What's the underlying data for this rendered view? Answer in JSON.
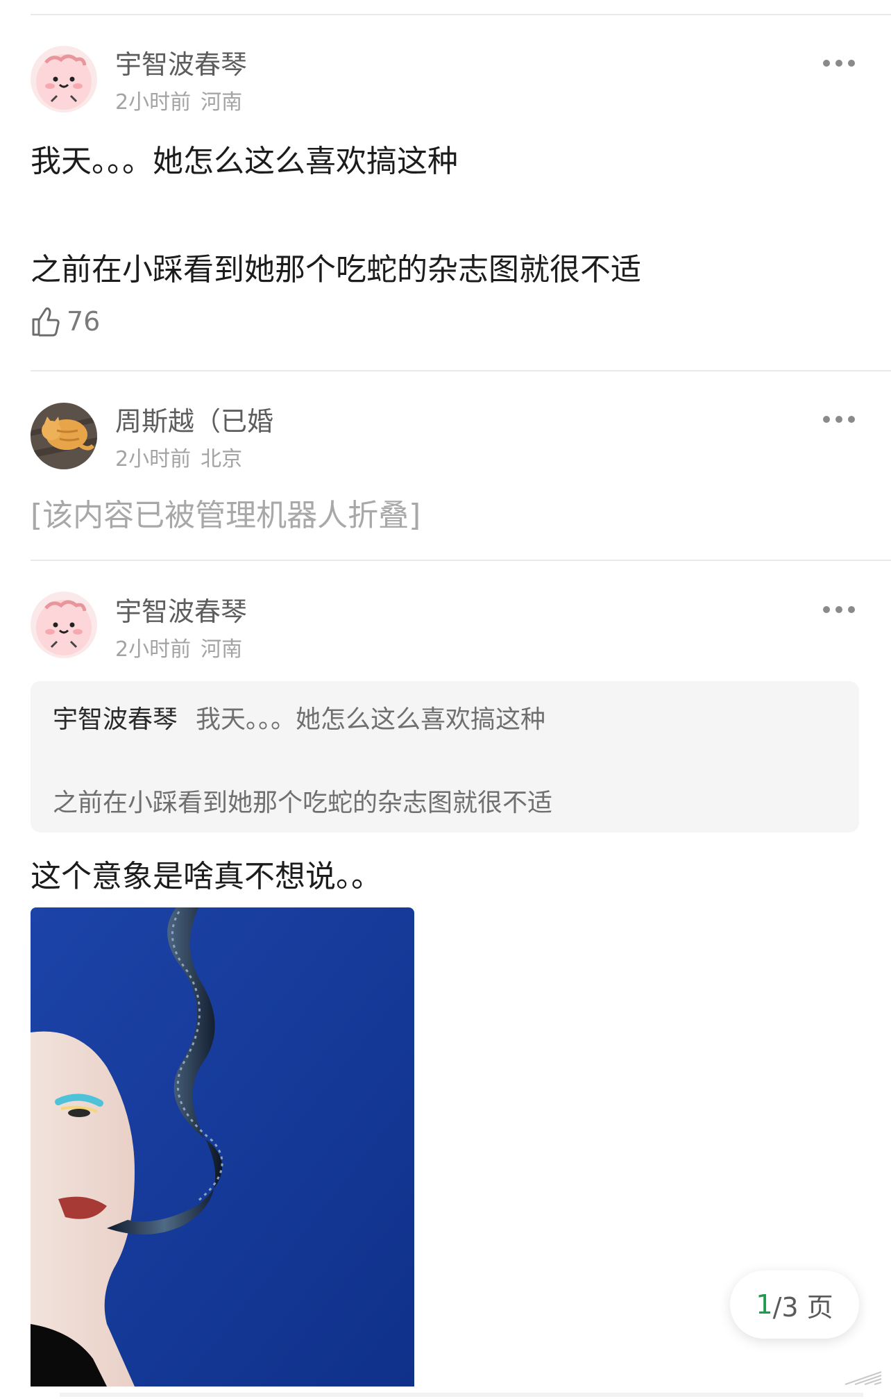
{
  "posts": [
    {
      "username": "宇智波春琴",
      "time": "2小时前",
      "location": "河南",
      "lines": [
        "我天。。。她怎么这么喜欢搞这种",
        "之前在小踩看到她那个吃蛇的杂志图就很不适"
      ],
      "likes": "76",
      "avatar_icon": "pink-blob-avatar-icon"
    },
    {
      "username": "周斯越（已婚",
      "time": "2小时前",
      "location": "北京",
      "folded_notice": "[该内容已被管理机器人折叠]",
      "avatar_icon": "orange-cat-avatar-icon"
    },
    {
      "username": "宇智波春琴",
      "time": "2小时前",
      "location": "河南",
      "quote": {
        "name": "宇智波春琴",
        "line1": "我天。。。她怎么这么喜欢搞这种",
        "line2": "之前在小踩看到她那个吃蛇的杂志图就很不适"
      },
      "text": "这个意象是啥真不想说。。",
      "avatar_icon": "pink-blob-avatar-icon"
    }
  ],
  "pager": {
    "current": "1",
    "rest": "/3 页"
  },
  "colors": {
    "accent_green": "#1d9b4c",
    "photo_blue": "#123a9c"
  }
}
